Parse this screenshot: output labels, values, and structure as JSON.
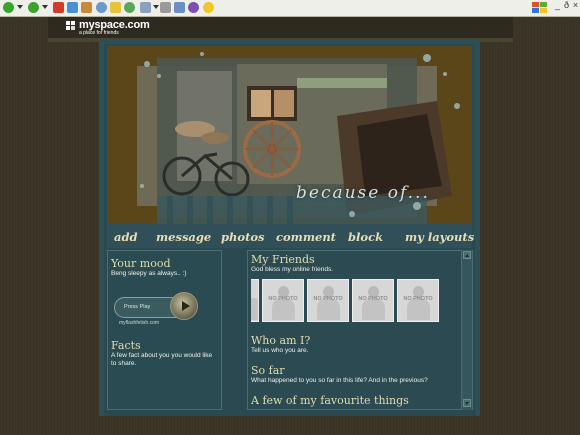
{
  "brand": {
    "name": "myspace.com",
    "tagline": "a place for friends"
  },
  "banner": {
    "caption": "because of..."
  },
  "nav": [
    "add",
    "message",
    "photos",
    "comment",
    "block",
    "my layouts"
  ],
  "left": {
    "mood_title": "Your mood",
    "mood_text": "Beng sleepy as always.. :)",
    "player_label": "Press Play",
    "player_credit": "myflashfetish.com",
    "facts_title": "Facts",
    "facts_text": "A few fact about you you would like to share."
  },
  "right": {
    "friends_title": "My Friends",
    "friends_text": "God bless my online friends.",
    "friends": [
      {
        "label": "NO PHOTO"
      },
      {
        "label": "NO PHOTO"
      },
      {
        "label": "NO PHOTO"
      },
      {
        "label": "NO PHOTO"
      },
      {
        "label": "NO PHOTO"
      }
    ],
    "who_title": "Who am I?",
    "who_text": "Tell us who you are.",
    "sofar_title": "So far",
    "sofar_text": "What happened to you so far in this life? And in the previous?",
    "favs_title": "A few of my favourite things"
  },
  "window": {
    "minimize": "_",
    "restore": "ð",
    "close": "×"
  }
}
